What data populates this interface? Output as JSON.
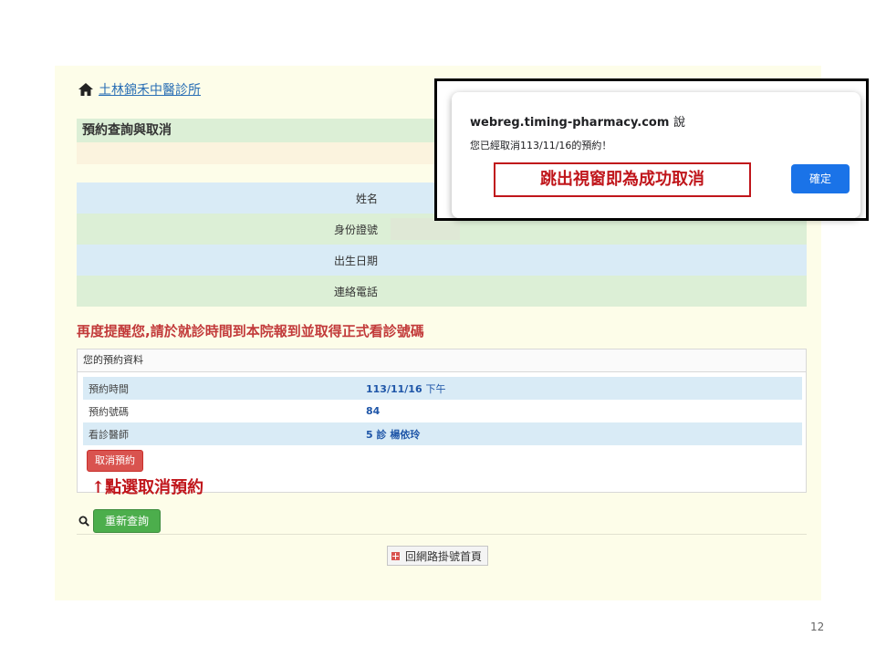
{
  "clinic": {
    "name": "土林錦禾中醫診所"
  },
  "section": {
    "title": "預約查詢與取消"
  },
  "patient_info": {
    "rows": [
      {
        "label": "姓名"
      },
      {
        "label": "身份證號"
      },
      {
        "label": "出生日期"
      },
      {
        "label": "連絡電話"
      }
    ]
  },
  "reminder": "再度提醒您,請於就診時間到本院報到並取得正式看診號碼",
  "appointment": {
    "header": "您的預約資料",
    "rows": [
      {
        "label": "預約時間",
        "value": "113/11/16",
        "value_extra": "下午"
      },
      {
        "label": "預約號碼",
        "value": "84"
      },
      {
        "label": "看診醫師",
        "value": "5 診 楊依玲"
      }
    ],
    "cancel_label": "取消預約"
  },
  "annotation_cancel": "↑點選取消預約",
  "requery_label": "重新查詢",
  "home_label": "回網路掛號首頁",
  "dialog": {
    "site": "webreg.timing-pharmacy.com",
    "say": "說",
    "message": "您已經取消113/11/16的預約！",
    "note": "跳出視窗即為成功取消",
    "ok_label": "確定"
  },
  "slide_number": "12",
  "colors": {
    "accent_red": "#c0161b",
    "link_blue": "#2a6fb5",
    "ok_blue": "#1a73e8",
    "green_button": "#4cae4c",
    "cancel_red": "#d9534f"
  }
}
